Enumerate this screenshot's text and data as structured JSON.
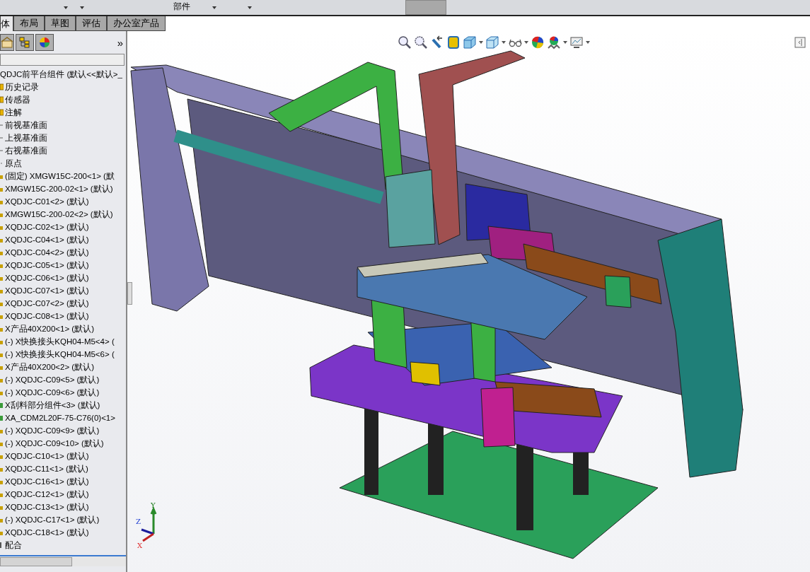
{
  "toolbar": {
    "partial_label": "部件"
  },
  "tabs": [
    {
      "label": "体",
      "selected": true
    },
    {
      "label": "布局",
      "selected": false
    },
    {
      "label": "草图",
      "selected": false
    },
    {
      "label": "评估",
      "selected": false
    },
    {
      "label": "办公室产品",
      "selected": false
    }
  ],
  "panel_toolbar": {
    "more": "»"
  },
  "tree": {
    "root": "QDJC前平台组件  (默认<<默认>_",
    "children": [
      {
        "kind": "folder",
        "label": "历史记录"
      },
      {
        "kind": "folder",
        "label": "传感器"
      },
      {
        "kind": "folder",
        "label": "注解"
      },
      {
        "kind": "plane",
        "label": "前视基准面"
      },
      {
        "kind": "plane",
        "label": "上视基准面"
      },
      {
        "kind": "plane",
        "label": "右视基准面"
      },
      {
        "kind": "origin",
        "label": "原点"
      },
      {
        "kind": "part",
        "label": "(固定) XMGW15C-200<1> (默"
      },
      {
        "kind": "part",
        "label": "XMGW15C-200-02<1> (默认)"
      },
      {
        "kind": "part",
        "label": "XQDJC-C01<2> (默认)"
      },
      {
        "kind": "part",
        "label": "XMGW15C-200-02<2> (默认)"
      },
      {
        "kind": "part",
        "label": "XQDJC-C02<1> (默认)"
      },
      {
        "kind": "part",
        "label": "XQDJC-C04<1> (默认)"
      },
      {
        "kind": "part",
        "label": "XQDJC-C04<2> (默认)"
      },
      {
        "kind": "part",
        "label": "XQDJC-C05<1> (默认)"
      },
      {
        "kind": "part",
        "label": "XQDJC-C06<1> (默认)"
      },
      {
        "kind": "part",
        "label": "XQDJC-C07<1> (默认)"
      },
      {
        "kind": "part",
        "label": "XQDJC-C07<2> (默认)"
      },
      {
        "kind": "part",
        "label": "XQDJC-C08<1> (默认)"
      },
      {
        "kind": "part",
        "label": "X产品40X200<1> (默认)"
      },
      {
        "kind": "part",
        "label": "(-) X快换接头KQH04-M5<4> ("
      },
      {
        "kind": "part",
        "label": "(-) X快换接头KQH04-M5<6> ("
      },
      {
        "kind": "part",
        "label": "X产品40X200<2> (默认)"
      },
      {
        "kind": "part",
        "label": "(-) XQDJC-C09<5> (默认)"
      },
      {
        "kind": "part",
        "label": "(-) XQDJC-C09<6> (默认)"
      },
      {
        "kind": "assembly",
        "label": "X刮料部分组件<3> (默认)"
      },
      {
        "kind": "assembly",
        "label": "XA_CDM2L20F-75-C76(0)<1>"
      },
      {
        "kind": "part",
        "label": "(-) XQDJC-C09<9> (默认)"
      },
      {
        "kind": "part",
        "label": "(-) XQDJC-C09<10> (默认)"
      },
      {
        "kind": "part",
        "label": "XQDJC-C10<1> (默认)"
      },
      {
        "kind": "part",
        "label": "XQDJC-C11<1> (默认)"
      },
      {
        "kind": "part",
        "label": "XQDJC-C16<1> (默认)"
      },
      {
        "kind": "part",
        "label": "XQDJC-C12<1> (默认)"
      },
      {
        "kind": "part",
        "label": "XQDJC-C13<1> (默认)"
      },
      {
        "kind": "part",
        "label": "(-) XQDJC-C17<1> (默认)"
      },
      {
        "kind": "part",
        "label": "XQDJC-C18<1> (默认)"
      },
      {
        "kind": "mates",
        "label": "配合"
      }
    ]
  },
  "triad": {
    "y": "Y",
    "z": "Z",
    "x": "X"
  }
}
